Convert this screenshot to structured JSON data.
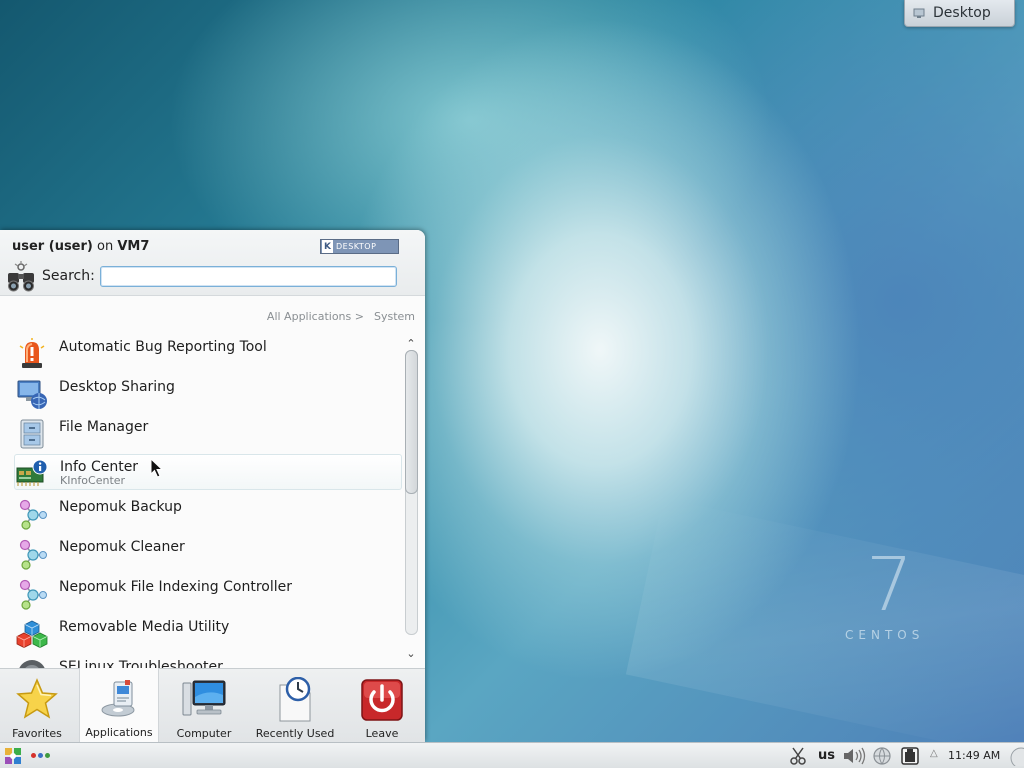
{
  "desktop": {
    "tag_label": "Desktop",
    "logo_number": "7",
    "logo_word": "CENTOS"
  },
  "kickoff": {
    "user_name": "user (user)",
    "on_word": "on",
    "host": "VM7",
    "kde_logo_text": "DESKTOP",
    "search_label": "Search:",
    "search_value": "",
    "breadcrumb": {
      "parent": "All Applications >",
      "current": "System"
    },
    "apps": [
      {
        "name": "Automatic Bug Reporting Tool",
        "sub": "",
        "icon": "alarm-icon"
      },
      {
        "name": "Desktop Sharing",
        "sub": "",
        "icon": "desktop-sharing-icon"
      },
      {
        "name": "File Manager",
        "sub": "",
        "icon": "file-cabinet-icon"
      },
      {
        "name": "Info Center",
        "sub": "KInfoCenter",
        "icon": "info-board-icon"
      },
      {
        "name": "Nepomuk Backup",
        "sub": "",
        "icon": "nepomuk-icon"
      },
      {
        "name": "Nepomuk Cleaner",
        "sub": "",
        "icon": "nepomuk-icon"
      },
      {
        "name": "Nepomuk File Indexing Controller",
        "sub": "",
        "icon": "nepomuk-icon"
      },
      {
        "name": "Removable Media Utility",
        "sub": "",
        "icon": "cubes-icon"
      },
      {
        "name": "SELinux Troubleshooter",
        "sub": "",
        "icon": "selinux-icon"
      }
    ],
    "tabs": [
      {
        "label": "Favorites",
        "icon": "star-icon",
        "active": false
      },
      {
        "label": "Applications",
        "icon": "applications-icon",
        "active": true
      },
      {
        "label": "Computer",
        "icon": "computer-icon",
        "active": false
      },
      {
        "label": "Recently Used",
        "icon": "recent-clock-icon",
        "active": false
      },
      {
        "label": "Leave",
        "icon": "power-icon",
        "active": false
      }
    ]
  },
  "panel": {
    "keyboard_layout": "us",
    "clock": "11:49 AM"
  },
  "colors": {
    "leave_red": "#c8282a",
    "selection_border": "#7ab0d8"
  }
}
